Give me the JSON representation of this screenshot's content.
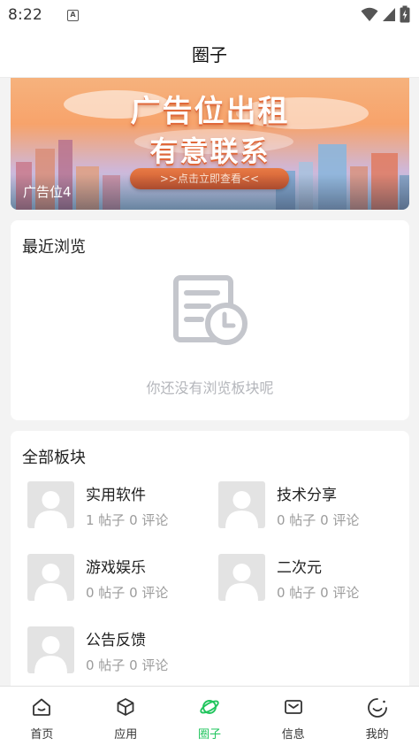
{
  "status_bar": {
    "time": "8:22",
    "notification_badge": "A"
  },
  "header": {
    "title": "圈子"
  },
  "banner": {
    "headline": "广告位出租",
    "subheadline": "有意联系",
    "button_label": ">>点击立即查看<<",
    "slot_label": "广告位4"
  },
  "recent": {
    "title": "最近浏览",
    "empty_text": "你还没有浏览板块呢"
  },
  "boards": {
    "title": "全部板块",
    "items": [
      {
        "name": "实用软件",
        "stats": "1 帖子 0 评论"
      },
      {
        "name": "技术分享",
        "stats": "0 帖子 0 评论"
      },
      {
        "name": "游戏娱乐",
        "stats": "0 帖子 0 评论"
      },
      {
        "name": "二次元",
        "stats": "0 帖子 0 评论"
      },
      {
        "name": "公告反馈",
        "stats": "0 帖子 0 评论"
      }
    ]
  },
  "bottom_nav": {
    "items": [
      {
        "label": "首页",
        "icon": "home-icon"
      },
      {
        "label": "应用",
        "icon": "cube-icon"
      },
      {
        "label": "圈子",
        "icon": "planet-icon",
        "active": true
      },
      {
        "label": "信息",
        "icon": "mail-icon"
      },
      {
        "label": "我的",
        "icon": "smile-icon"
      }
    ]
  },
  "colors": {
    "accent": "#22c55e",
    "background": "#f3f3f3",
    "muted_text": "#9c9c9c"
  }
}
